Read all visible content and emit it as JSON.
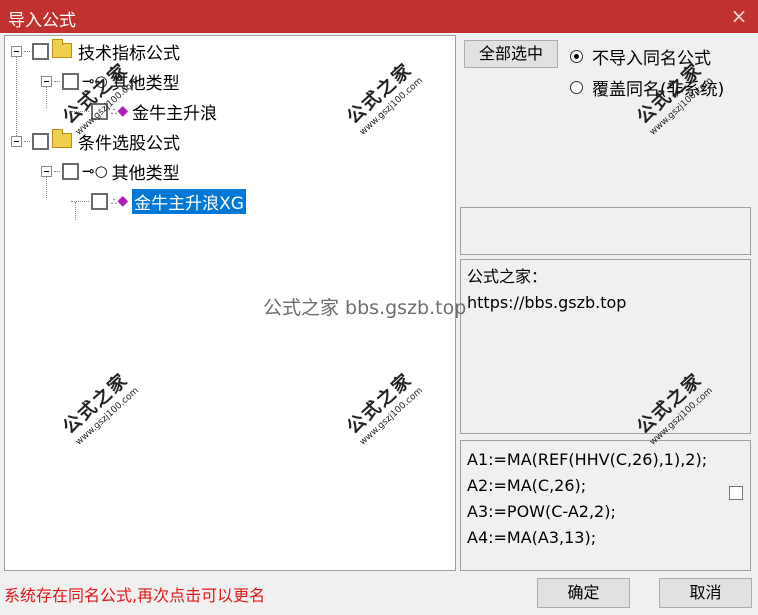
{
  "window": {
    "title": "导入公式",
    "close_icon": "×"
  },
  "tree": {
    "nodes": [
      {
        "label": "技术指标公式",
        "icon": "folder-icon"
      },
      {
        "label": "其他类型",
        "icon": "key-icon"
      },
      {
        "label": "金牛主升浪",
        "icon": "formula-icon"
      },
      {
        "label": "条件选股公式",
        "icon": "folder-icon"
      },
      {
        "label": "其他类型",
        "icon": "key-icon"
      },
      {
        "label": "金牛主升浪XG",
        "icon": "formula-icon",
        "selected": true
      }
    ],
    "icon_glyphs": {
      "key": "⊸○",
      "formula_dots": "∴",
      "formula_diamond": "◆"
    }
  },
  "options": {
    "select_all_label": "全部选中",
    "radio_no_import": "不导入同名公式",
    "radio_overwrite": "覆盖同名(非系统)",
    "selected_radio": "不导入同名公式"
  },
  "info": {
    "line1": "公式之家：",
    "line2": "https://bbs.gszb.top"
  },
  "code": {
    "lines": [
      "A1:=MA(REF(HHV(C,26),1),2);",
      "A2:=MA(C,26);",
      "A3:=POW(C-A2,2);",
      "A4:=MA(A3,13);"
    ]
  },
  "status": {
    "message": "系统存在同名公式,再次点击可以更名"
  },
  "buttons": {
    "ok": "确定",
    "cancel": "取消"
  },
  "watermarks": {
    "center_text": "公式之家 bbs.gszb.top",
    "stamp_title": "公式之家",
    "stamp_url": "www.gszj100.com"
  },
  "colors": {
    "titlebar": "#c0312f",
    "selection": "#0078d7",
    "status_text": "#e21818"
  }
}
